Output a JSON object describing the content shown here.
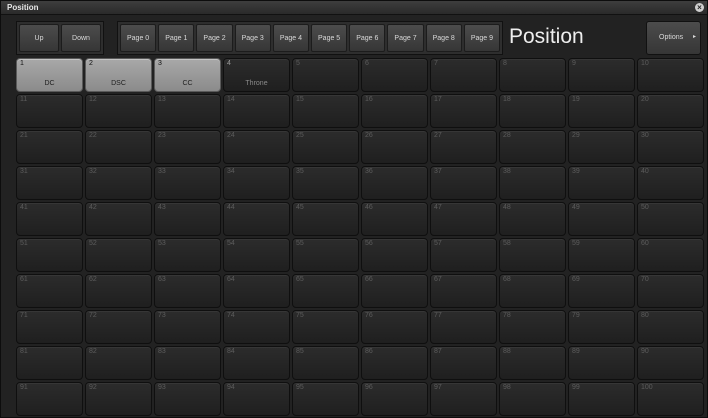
{
  "window": {
    "title": "Position",
    "close_glyph": "×"
  },
  "nav": {
    "up": "Up",
    "down": "Down"
  },
  "pages": [
    "Page 0",
    "Page 1",
    "Page 2",
    "Page 3",
    "Page 4",
    "Page 5",
    "Page 6",
    "Page 7",
    "Page 8",
    "Page 9"
  ],
  "heading": "Position",
  "options": {
    "label": "Options",
    "caret": "▸"
  },
  "cells": [
    {
      "num": "1",
      "name": "DC",
      "active": true
    },
    {
      "num": "2",
      "name": "DSC",
      "active": true
    },
    {
      "num": "3",
      "name": "CC",
      "active": true
    },
    {
      "num": "4",
      "name": "Throne",
      "active": false
    },
    {
      "num": "5",
      "name": "",
      "active": false
    },
    {
      "num": "6",
      "name": "",
      "active": false
    },
    {
      "num": "7",
      "name": "",
      "active": false
    },
    {
      "num": "8",
      "name": "",
      "active": false
    },
    {
      "num": "9",
      "name": "",
      "active": false
    },
    {
      "num": "10",
      "name": "",
      "active": false
    },
    {
      "num": "11",
      "name": "",
      "active": false
    },
    {
      "num": "12",
      "name": "",
      "active": false
    },
    {
      "num": "13",
      "name": "",
      "active": false
    },
    {
      "num": "14",
      "name": "",
      "active": false
    },
    {
      "num": "15",
      "name": "",
      "active": false
    },
    {
      "num": "16",
      "name": "",
      "active": false
    },
    {
      "num": "17",
      "name": "",
      "active": false
    },
    {
      "num": "18",
      "name": "",
      "active": false
    },
    {
      "num": "19",
      "name": "",
      "active": false
    },
    {
      "num": "20",
      "name": "",
      "active": false
    },
    {
      "num": "21",
      "name": "",
      "active": false
    },
    {
      "num": "22",
      "name": "",
      "active": false
    },
    {
      "num": "23",
      "name": "",
      "active": false
    },
    {
      "num": "24",
      "name": "",
      "active": false
    },
    {
      "num": "25",
      "name": "",
      "active": false
    },
    {
      "num": "26",
      "name": "",
      "active": false
    },
    {
      "num": "27",
      "name": "",
      "active": false
    },
    {
      "num": "28",
      "name": "",
      "active": false
    },
    {
      "num": "29",
      "name": "",
      "active": false
    },
    {
      "num": "30",
      "name": "",
      "active": false
    },
    {
      "num": "31",
      "name": "",
      "active": false
    },
    {
      "num": "32",
      "name": "",
      "active": false
    },
    {
      "num": "33",
      "name": "",
      "active": false
    },
    {
      "num": "34",
      "name": "",
      "active": false
    },
    {
      "num": "35",
      "name": "",
      "active": false
    },
    {
      "num": "36",
      "name": "",
      "active": false
    },
    {
      "num": "37",
      "name": "",
      "active": false
    },
    {
      "num": "38",
      "name": "",
      "active": false
    },
    {
      "num": "39",
      "name": "",
      "active": false
    },
    {
      "num": "40",
      "name": "",
      "active": false
    },
    {
      "num": "41",
      "name": "",
      "active": false
    },
    {
      "num": "42",
      "name": "",
      "active": false
    },
    {
      "num": "43",
      "name": "",
      "active": false
    },
    {
      "num": "44",
      "name": "",
      "active": false
    },
    {
      "num": "45",
      "name": "",
      "active": false
    },
    {
      "num": "46",
      "name": "",
      "active": false
    },
    {
      "num": "47",
      "name": "",
      "active": false
    },
    {
      "num": "48",
      "name": "",
      "active": false
    },
    {
      "num": "49",
      "name": "",
      "active": false
    },
    {
      "num": "50",
      "name": "",
      "active": false
    },
    {
      "num": "51",
      "name": "",
      "active": false
    },
    {
      "num": "52",
      "name": "",
      "active": false
    },
    {
      "num": "53",
      "name": "",
      "active": false
    },
    {
      "num": "54",
      "name": "",
      "active": false
    },
    {
      "num": "55",
      "name": "",
      "active": false
    },
    {
      "num": "56",
      "name": "",
      "active": false
    },
    {
      "num": "57",
      "name": "",
      "active": false
    },
    {
      "num": "58",
      "name": "",
      "active": false
    },
    {
      "num": "59",
      "name": "",
      "active": false
    },
    {
      "num": "60",
      "name": "",
      "active": false
    },
    {
      "num": "61",
      "name": "",
      "active": false
    },
    {
      "num": "62",
      "name": "",
      "active": false
    },
    {
      "num": "63",
      "name": "",
      "active": false
    },
    {
      "num": "64",
      "name": "",
      "active": false
    },
    {
      "num": "65",
      "name": "",
      "active": false
    },
    {
      "num": "66",
      "name": "",
      "active": false
    },
    {
      "num": "67",
      "name": "",
      "active": false
    },
    {
      "num": "68",
      "name": "",
      "active": false
    },
    {
      "num": "69",
      "name": "",
      "active": false
    },
    {
      "num": "70",
      "name": "",
      "active": false
    },
    {
      "num": "71",
      "name": "",
      "active": false
    },
    {
      "num": "72",
      "name": "",
      "active": false
    },
    {
      "num": "73",
      "name": "",
      "active": false
    },
    {
      "num": "74",
      "name": "",
      "active": false
    },
    {
      "num": "75",
      "name": "",
      "active": false
    },
    {
      "num": "76",
      "name": "",
      "active": false
    },
    {
      "num": "77",
      "name": "",
      "active": false
    },
    {
      "num": "78",
      "name": "",
      "active": false
    },
    {
      "num": "79",
      "name": "",
      "active": false
    },
    {
      "num": "80",
      "name": "",
      "active": false
    },
    {
      "num": "81",
      "name": "",
      "active": false
    },
    {
      "num": "82",
      "name": "",
      "active": false
    },
    {
      "num": "83",
      "name": "",
      "active": false
    },
    {
      "num": "84",
      "name": "",
      "active": false
    },
    {
      "num": "85",
      "name": "",
      "active": false
    },
    {
      "num": "86",
      "name": "",
      "active": false
    },
    {
      "num": "87",
      "name": "",
      "active": false
    },
    {
      "num": "88",
      "name": "",
      "active": false
    },
    {
      "num": "89",
      "name": "",
      "active": false
    },
    {
      "num": "90",
      "name": "",
      "active": false
    },
    {
      "num": "91",
      "name": "",
      "active": false
    },
    {
      "num": "92",
      "name": "",
      "active": false
    },
    {
      "num": "93",
      "name": "",
      "active": false
    },
    {
      "num": "94",
      "name": "",
      "active": false
    },
    {
      "num": "95",
      "name": "",
      "active": false
    },
    {
      "num": "96",
      "name": "",
      "active": false
    },
    {
      "num": "97",
      "name": "",
      "active": false
    },
    {
      "num": "98",
      "name": "",
      "active": false
    },
    {
      "num": "99",
      "name": "",
      "active": false
    },
    {
      "num": "100",
      "name": "",
      "active": false
    }
  ]
}
